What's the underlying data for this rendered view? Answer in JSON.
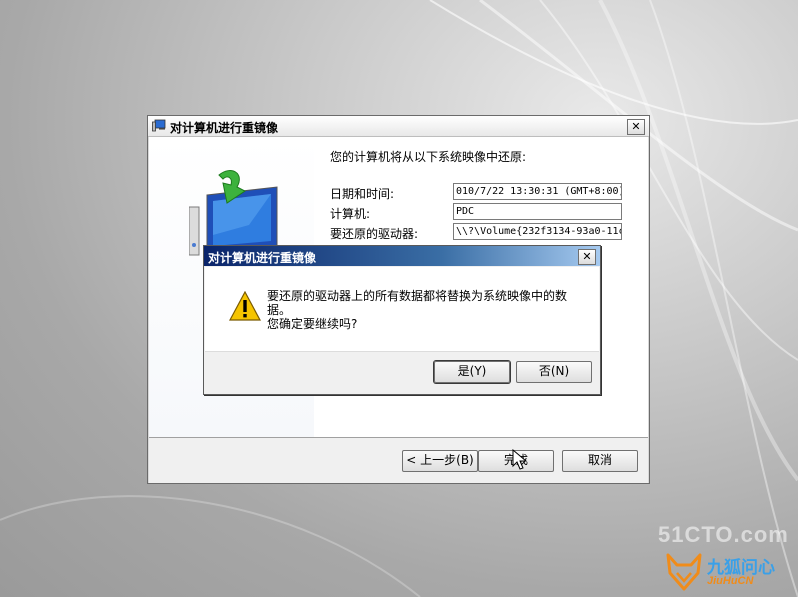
{
  "wizard": {
    "title": "对计算机进行重镜像",
    "close_glyph": "✕",
    "heading": "您的计算机将从以下系统映像中还原:",
    "fields": [
      {
        "label": "日期和时间:",
        "value": "010/7/22 13:30:31 (GMT+8:00)"
      },
      {
        "label": "计算机:",
        "value": "PDC"
      },
      {
        "label": "要还原的驱动器:",
        "value": "\\\\?\\Volume{232f3134-93a0-11c"
      }
    ],
    "buttons": {
      "back": "< 上一步(B)",
      "finish": "完成",
      "cancel": "取消"
    }
  },
  "dialog": {
    "title": "对计算机进行重镜像",
    "close_glyph": "✕",
    "message_line1": "要还原的驱动器上的所有数据都将替换为系统映像中的数",
    "message_line2": "据。",
    "message_line3": "您确定要继续吗?",
    "buttons": {
      "yes": "是(Y)",
      "no": "否(N)"
    }
  },
  "watermarks": {
    "site1": "51CTO.com",
    "site2_cn": "九狐问心",
    "site2_en": "JiuHuCN"
  },
  "colors": {
    "dialog_title_start": "#0a246a",
    "dialog_title_end": "#a6caf0",
    "warning_yellow": "#f5c400"
  }
}
